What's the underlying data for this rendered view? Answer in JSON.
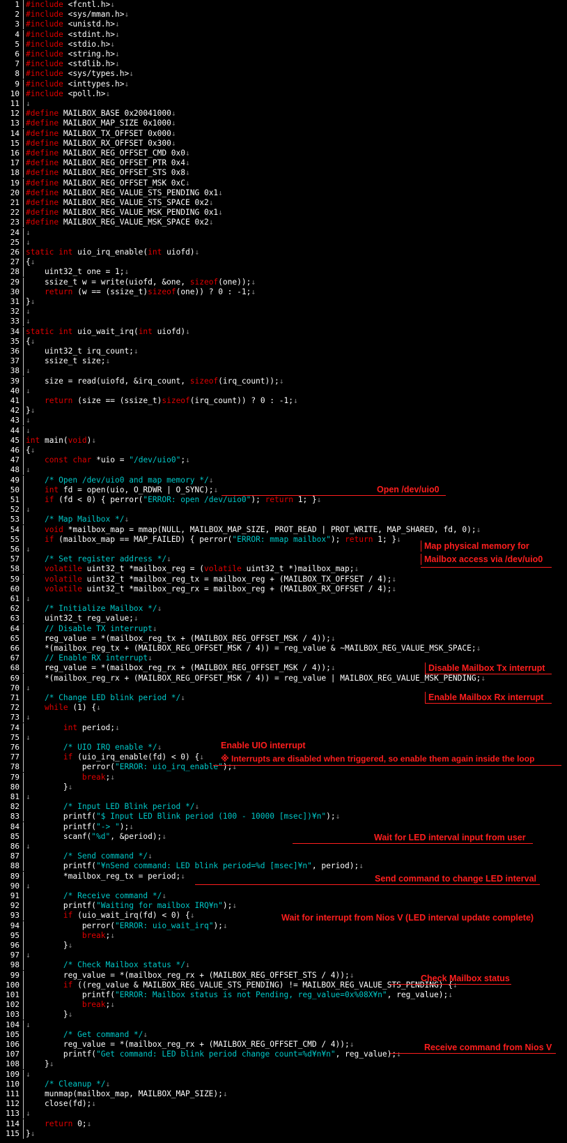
{
  "editor": {
    "lines": [
      {
        "n": "1",
        "t": "#include <fcntl.h>"
      },
      {
        "n": "2",
        "t": "#include <sys/mman.h>"
      },
      {
        "n": "3",
        "t": "#include <unistd.h>"
      },
      {
        "n": "4",
        "t": "#include <stdint.h>"
      },
      {
        "n": "5",
        "t": "#include <stdio.h>"
      },
      {
        "n": "6",
        "t": "#include <string.h>"
      },
      {
        "n": "7",
        "t": "#include <stdlib.h>"
      },
      {
        "n": "8",
        "t": "#include <sys/types.h>"
      },
      {
        "n": "9",
        "t": "#include <inttypes.h>"
      },
      {
        "n": "10",
        "t": "#include <poll.h>"
      },
      {
        "n": "11",
        "t": ""
      },
      {
        "n": "12",
        "t": "#define MAILBOX_BASE 0x20041000"
      },
      {
        "n": "13",
        "t": "#define MAILBOX_MAP_SIZE 0x1000"
      },
      {
        "n": "14",
        "t": "#define MAILBOX_TX_OFFSET 0x000"
      },
      {
        "n": "15",
        "t": "#define MAILBOX_RX_OFFSET 0x300"
      },
      {
        "n": "16",
        "t": "#define MAILBOX_REG_OFFSET_CMD 0x0"
      },
      {
        "n": "17",
        "t": "#define MAILBOX_REG_OFFSET_PTR 0x4"
      },
      {
        "n": "18",
        "t": "#define MAILBOX_REG_OFFSET_STS 0x8"
      },
      {
        "n": "19",
        "t": "#define MAILBOX_REG_OFFSET_MSK 0xC"
      },
      {
        "n": "20",
        "t": "#define MAILBOX_REG_VALUE_STS_PENDING 0x1"
      },
      {
        "n": "21",
        "t": "#define MAILBOX_REG_VALUE_STS_SPACE 0x2"
      },
      {
        "n": "22",
        "t": "#define MAILBOX_REG_VALUE_MSK_PENDING 0x1"
      },
      {
        "n": "23",
        "t": "#define MAILBOX_REG_VALUE_MSK_SPACE 0x2"
      },
      {
        "n": "24",
        "t": ""
      },
      {
        "n": "25",
        "t": ""
      },
      {
        "n": "26",
        "t": "static int uio_irq_enable(int uiofd)"
      },
      {
        "n": "27",
        "t": "{"
      },
      {
        "n": "28",
        "t": "    uint32_t one = 1;"
      },
      {
        "n": "29",
        "t": "    ssize_t w = write(uiofd, &one, sizeof(one));"
      },
      {
        "n": "30",
        "t": "    return (w == (ssize_t)sizeof(one)) ? 0 : -1;"
      },
      {
        "n": "31",
        "t": "}"
      },
      {
        "n": "32",
        "t": ""
      },
      {
        "n": "33",
        "t": ""
      },
      {
        "n": "34",
        "t": "static int uio_wait_irq(int uiofd)"
      },
      {
        "n": "35",
        "t": "{"
      },
      {
        "n": "36",
        "t": "    uint32_t irq_count;"
      },
      {
        "n": "37",
        "t": "    ssize_t size;"
      },
      {
        "n": "38",
        "t": ""
      },
      {
        "n": "39",
        "t": "    size = read(uiofd, &irq_count, sizeof(irq_count));"
      },
      {
        "n": "40",
        "t": ""
      },
      {
        "n": "41",
        "t": "    return (size == (ssize_t)sizeof(irq_count)) ? 0 : -1;"
      },
      {
        "n": "42",
        "t": "}"
      },
      {
        "n": "43",
        "t": ""
      },
      {
        "n": "44",
        "t": ""
      },
      {
        "n": "45",
        "t": "int main(void)"
      },
      {
        "n": "46",
        "t": "{"
      },
      {
        "n": "47",
        "t": "    const char *uio = \"/dev/uio0\";"
      },
      {
        "n": "48",
        "t": ""
      },
      {
        "n": "49",
        "t": "    /* Open /dev/uio0 and map memory */"
      },
      {
        "n": "50",
        "t": "    int fd = open(uio, O_RDWR | O_SYNC);"
      },
      {
        "n": "51",
        "t": "    if (fd < 0) { perror(\"ERROR: open /dev/uio0\"); return 1; }"
      },
      {
        "n": "52",
        "t": ""
      },
      {
        "n": "53",
        "t": "    /* Map Mailbox */"
      },
      {
        "n": "54",
        "t": "    void *mailbox_map = mmap(NULL, MAILBOX_MAP_SIZE, PROT_READ | PROT_WRITE, MAP_SHARED, fd, 0);"
      },
      {
        "n": "55",
        "t": "    if (mailbox_map == MAP_FAILED) { perror(\"ERROR: mmap mailbox\"); return 1; }"
      },
      {
        "n": "56",
        "t": ""
      },
      {
        "n": "57",
        "t": "    /* Set register address */"
      },
      {
        "n": "58",
        "t": "    volatile uint32_t *mailbox_reg = (volatile uint32_t *)mailbox_map;"
      },
      {
        "n": "59",
        "t": "    volatile uint32_t *mailbox_reg_tx = mailbox_reg + (MAILBOX_TX_OFFSET / 4);"
      },
      {
        "n": "60",
        "t": "    volatile uint32_t *mailbox_reg_rx = mailbox_reg + (MAILBOX_RX_OFFSET / 4);"
      },
      {
        "n": "61",
        "t": ""
      },
      {
        "n": "62",
        "t": "    /* Initialize Mailbox */"
      },
      {
        "n": "63",
        "t": "    uint32_t reg_value;"
      },
      {
        "n": "64",
        "t": "    // Disable TX interrupt"
      },
      {
        "n": "65",
        "t": "    reg_value = *(mailbox_reg_tx + (MAILBOX_REG_OFFSET_MSK / 4));"
      },
      {
        "n": "66",
        "t": "    *(mailbox_reg_tx + (MAILBOX_REG_OFFSET_MSK / 4)) = reg_value & ~MAILBOX_REG_VALUE_MSK_SPACE;"
      },
      {
        "n": "67",
        "t": "    // Enable RX interrupt"
      },
      {
        "n": "68",
        "t": "    reg_value = *(mailbox_reg_rx + (MAILBOX_REG_OFFSET_MSK / 4));"
      },
      {
        "n": "69",
        "t": "    *(mailbox_reg_rx + (MAILBOX_REG_OFFSET_MSK / 4)) = reg_value | MAILBOX_REG_VALUE_MSK_PENDING;"
      },
      {
        "n": "70",
        "t": ""
      },
      {
        "n": "71",
        "t": "    /* Change LED blink period */"
      },
      {
        "n": "72",
        "t": "    while (1) {"
      },
      {
        "n": "73",
        "t": ""
      },
      {
        "n": "74",
        "t": "        int period;"
      },
      {
        "n": "75",
        "t": ""
      },
      {
        "n": "76",
        "t": "        /* UIO IRQ enable */"
      },
      {
        "n": "77",
        "t": "        if (uio_irq_enable(fd) < 0) {"
      },
      {
        "n": "78",
        "t": "            perror(\"ERROR: uio_irq_enable\");"
      },
      {
        "n": "79",
        "t": "            break;"
      },
      {
        "n": "80",
        "t": "        }"
      },
      {
        "n": "81",
        "t": ""
      },
      {
        "n": "82",
        "t": "        /* Input LED Blink period */"
      },
      {
        "n": "83",
        "t": "        printf(\"$ Input LED Blink period (100 - 10000 [msec])¥n\");"
      },
      {
        "n": "84",
        "t": "        printf(\"-> \");"
      },
      {
        "n": "85",
        "t": "        scanf(\"%d\", &period);"
      },
      {
        "n": "86",
        "t": ""
      },
      {
        "n": "87",
        "t": "        /* Send command */"
      },
      {
        "n": "88",
        "t": "        printf(\"¥nSend command: LED blink period=%d [msec]¥n\", period);"
      },
      {
        "n": "89",
        "t": "        *mailbox_reg_tx = period;"
      },
      {
        "n": "90",
        "t": ""
      },
      {
        "n": "91",
        "t": "        /* Receive command */"
      },
      {
        "n": "92",
        "t": "        printf(\"Waiting for mailbox IRQ¥n\");"
      },
      {
        "n": "93",
        "t": "        if (uio_wait_irq(fd) < 0) {"
      },
      {
        "n": "94",
        "t": "            perror(\"ERROR: uio_wait_irq\");"
      },
      {
        "n": "95",
        "t": "            break;"
      },
      {
        "n": "96",
        "t": "        }"
      },
      {
        "n": "97",
        "t": ""
      },
      {
        "n": "98",
        "t": "        /* Check Mailbox status */"
      },
      {
        "n": "99",
        "t": "        reg_value = *(mailbox_reg_rx + (MAILBOX_REG_OFFSET_STS / 4));"
      },
      {
        "n": "100",
        "t": "        if ((reg_value & MAILBOX_REG_VALUE_STS_PENDING) != MAILBOX_REG_VALUE_STS_PENDING) {"
      },
      {
        "n": "101",
        "t": "            printf(\"ERROR: Mailbox status is not Pending, reg_value=0x%08X¥n\", reg_value);"
      },
      {
        "n": "102",
        "t": "            break;"
      },
      {
        "n": "103",
        "t": "        }"
      },
      {
        "n": "104",
        "t": ""
      },
      {
        "n": "105",
        "t": "        /* Get command */"
      },
      {
        "n": "106",
        "t": "        reg_value = *(mailbox_reg_rx + (MAILBOX_REG_OFFSET_CMD / 4));"
      },
      {
        "n": "107",
        "t": "        printf(\"Get command: LED blink period change count=%d¥n¥n\", reg_value);"
      },
      {
        "n": "108",
        "t": "    }"
      },
      {
        "n": "109",
        "t": ""
      },
      {
        "n": "110",
        "t": "    /* Cleanup */"
      },
      {
        "n": "111",
        "t": "    munmap(mailbox_map, MAILBOX_MAP_SIZE);"
      },
      {
        "n": "112",
        "t": "    close(fd);"
      },
      {
        "n": "113",
        "t": ""
      },
      {
        "n": "114",
        "t": "    return 0;"
      },
      {
        "n": "115",
        "t": "}"
      }
    ],
    "newline_marker": "↓"
  },
  "annotations": {
    "open_uio": "Open /dev/uio0",
    "map_memory_1": "Map physical memory for",
    "map_memory_2": "Mailbox  access via /dev/uio0",
    "disable_tx": "Disable Mailbox Tx interrupt",
    "enable_rx": "Enable Mailbox Rx interrupt",
    "enable_uio": "Enable UIO interrupt",
    "uio_note": "※ Interrupts are disabled when triggered, so enable them again inside the loop",
    "wait_input": "Wait for LED interval input from user",
    "send_cmd": "Send command to change LED interval",
    "wait_irq": "Wait for interrupt from Nios V (LED interval update complete)",
    "check_status": "Check Mailbox status",
    "receive_cmd": "Receive command from Nios V"
  },
  "colors": {
    "background": "#000000",
    "text": "#ffffff",
    "keyword": "#e00000",
    "comment": "#00c8c8",
    "annotation": "#ff1e1e",
    "newline_marker": "#808080"
  }
}
